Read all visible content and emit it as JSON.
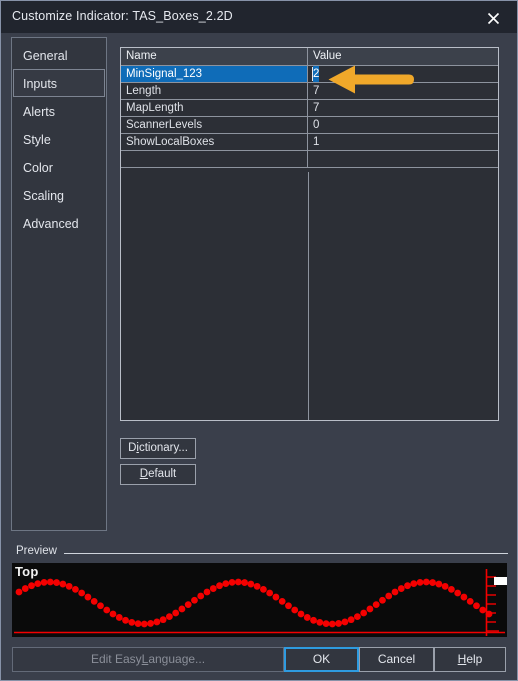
{
  "window": {
    "title": "Customize Indicator: TAS_Boxes_2.2D",
    "close_icon": "close-icon"
  },
  "sidebar": {
    "items": [
      {
        "label": "General",
        "selected": false
      },
      {
        "label": "Inputs",
        "selected": true
      },
      {
        "label": "Alerts",
        "selected": false
      },
      {
        "label": "Style",
        "selected": false
      },
      {
        "label": "Color",
        "selected": false
      },
      {
        "label": "Scaling",
        "selected": false
      },
      {
        "label": "Advanced",
        "selected": false
      }
    ]
  },
  "inputs_table": {
    "columns": [
      "Name",
      "Value"
    ],
    "rows": [
      {
        "name": "MinSignal_123",
        "value": "2",
        "selected": true,
        "editing": true
      },
      {
        "name": "Length",
        "value": "7",
        "selected": false,
        "editing": false
      },
      {
        "name": "MapLength",
        "value": "7",
        "selected": false,
        "editing": false
      },
      {
        "name": "ScannerLevels",
        "value": "0",
        "selected": false,
        "editing": false
      },
      {
        "name": "ShowLocalBoxes",
        "value": "1",
        "selected": false,
        "editing": false
      }
    ]
  },
  "annotation": {
    "type": "arrow-left",
    "color": "#f0a82a",
    "points_at": "MinSignal_123 value cell"
  },
  "side_buttons": {
    "dictionary_label": "Dictionary...",
    "dictionary_mnemonic": "i",
    "default_label": "Default",
    "default_mnemonic": "D"
  },
  "preview": {
    "group_label": "Preview",
    "chart_title": "Top",
    "plot_color": "#f40000",
    "background": "#0a0a0a",
    "axis_color": "#f40000"
  },
  "footer": {
    "edit_easylanguage_label": "Edit EasyLanguage...",
    "edit_easylanguage_enabled": false,
    "ok_label": "OK",
    "cancel_label": "Cancel",
    "help_label": "Help",
    "help_mnemonic": "H",
    "focus_color": "#2e9be0"
  },
  "chart_data": {
    "type": "scatter",
    "title": "Top",
    "series": [
      {
        "name": "Top",
        "color": "#f40000",
        "marker": "dot",
        "description": "Dotted sine wave, approximately 2.5 cycles across the preview width",
        "amplitude": 0.72,
        "cycles": 2.5,
        "point_count": 76
      }
    ],
    "xlabel": "",
    "ylabel": "",
    "grid": false,
    "legend": false
  }
}
